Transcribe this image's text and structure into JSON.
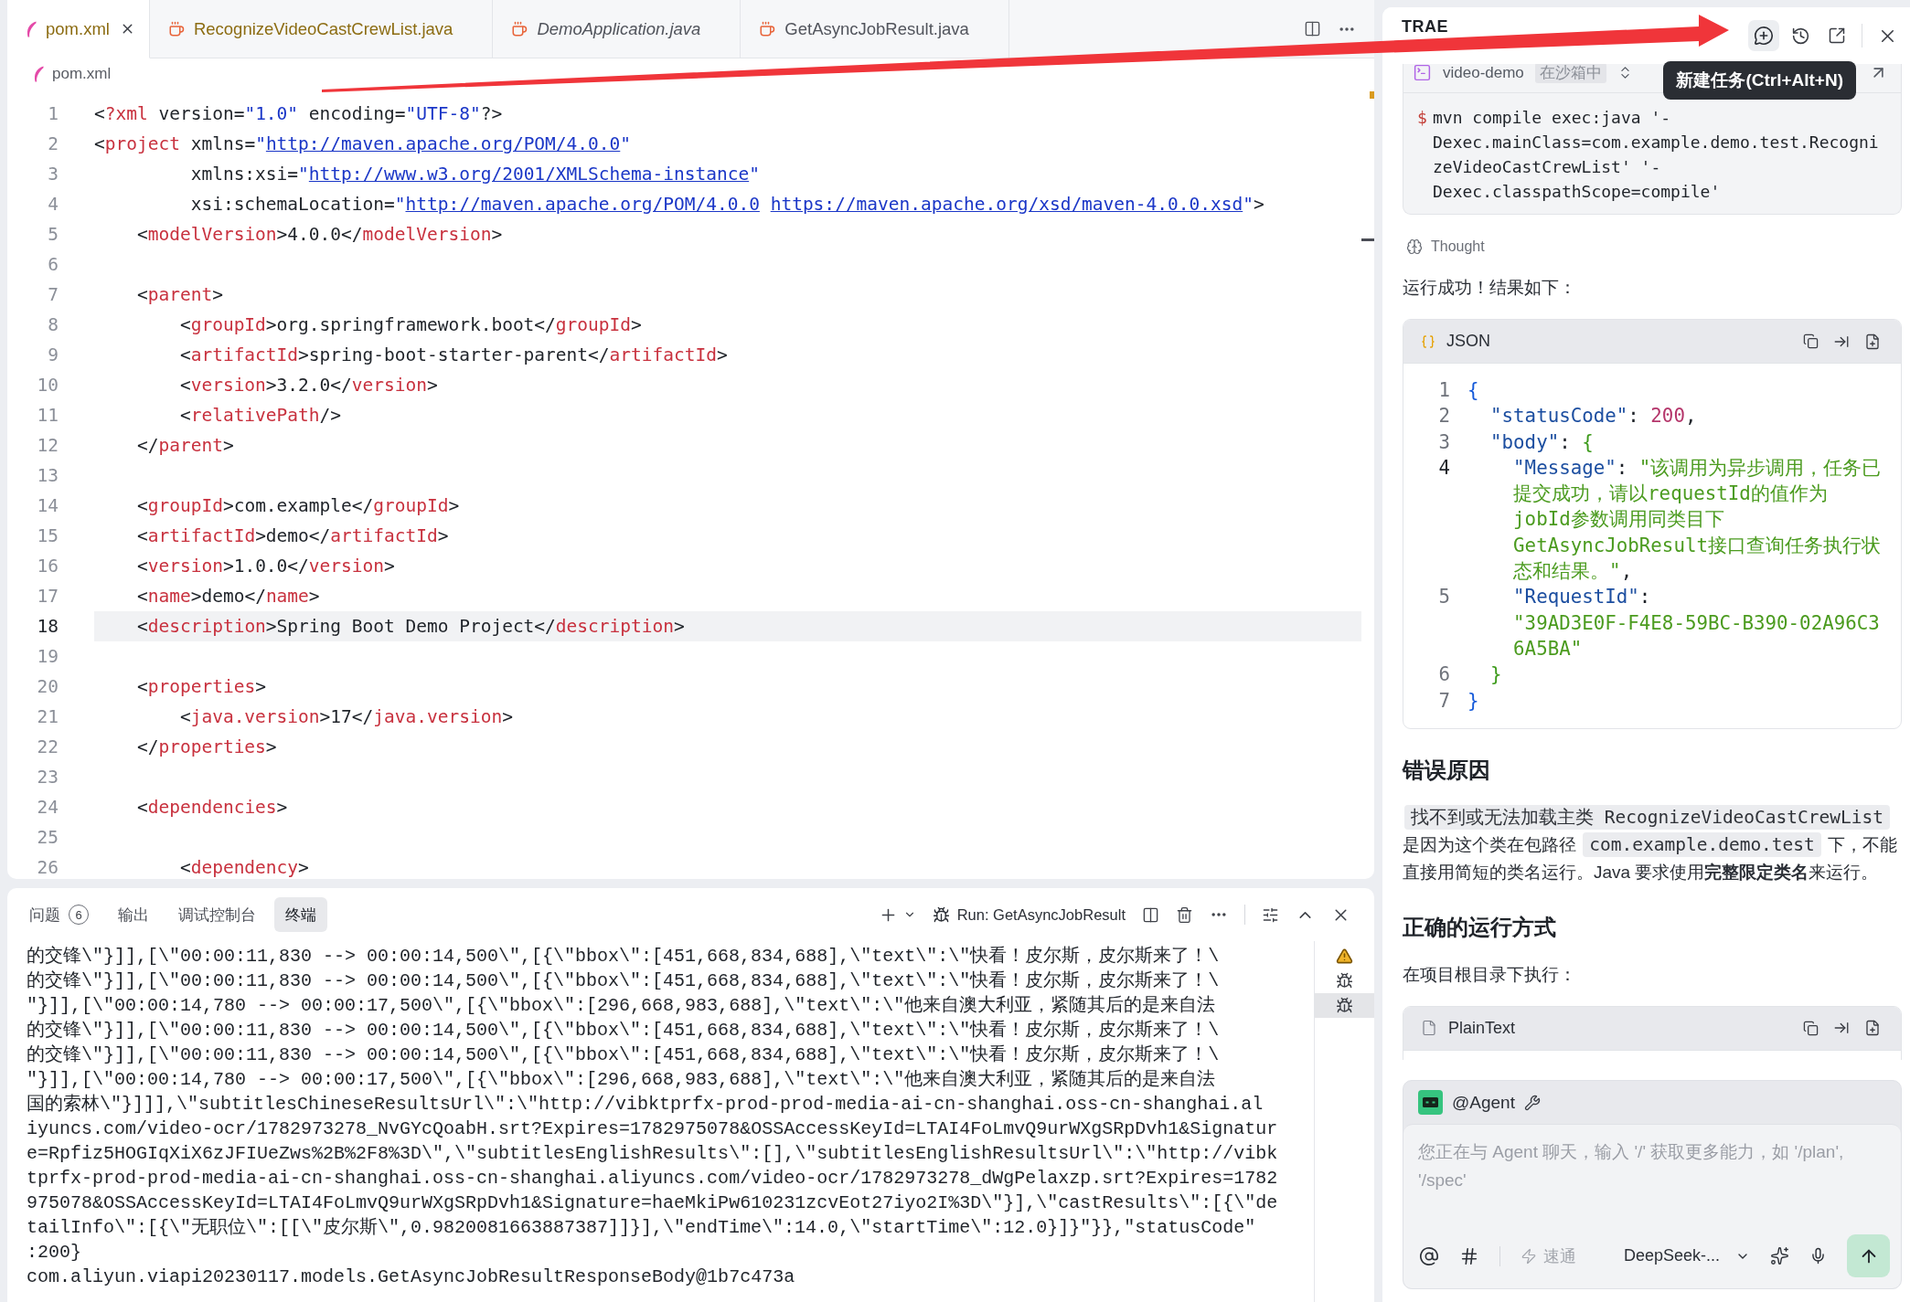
{
  "editor": {
    "tabs": [
      {
        "label": "pom.xml",
        "kind": "xml",
        "selected": true,
        "warning": true,
        "preview": false
      },
      {
        "label": "RecognizeVideoCastCrewList.java",
        "kind": "java",
        "selected": false,
        "warning": true,
        "preview": false
      },
      {
        "label": "DemoApplication.java",
        "kind": "java",
        "selected": false,
        "warning": false,
        "preview": true
      },
      {
        "label": "GetAsyncJobResult.java",
        "kind": "java",
        "selected": false,
        "warning": false,
        "preview": false
      }
    ],
    "breadcrumb": {
      "kind": "xml",
      "label": "pom.xml"
    },
    "lines": [
      {
        "number": "1",
        "current": false,
        "tokens": [
          {
            "kind": "plain",
            "text": "<"
          },
          {
            "kind": "tag",
            "text": "?xml"
          },
          {
            "kind": "plain",
            "text": " version="
          },
          {
            "kind": "string",
            "text": "\"1.0\""
          },
          {
            "kind": "plain",
            "text": " encoding="
          },
          {
            "kind": "string",
            "text": "\"UTF-8\""
          },
          {
            "kind": "plain",
            "text": "?>"
          }
        ]
      },
      {
        "number": "2",
        "current": false,
        "tokens": [
          {
            "kind": "plain",
            "text": "<"
          },
          {
            "kind": "tag",
            "text": "project"
          },
          {
            "kind": "plain",
            "text": " xmlns="
          },
          {
            "kind": "string",
            "text": "\""
          },
          {
            "kind": "link",
            "text": "http://maven.apache.org/POM/4.0.0"
          },
          {
            "kind": "string",
            "text": "\""
          }
        ]
      },
      {
        "number": "3",
        "current": false,
        "tokens": [
          {
            "kind": "plain",
            "text": "         xmlns:xsi="
          },
          {
            "kind": "string",
            "text": "\""
          },
          {
            "kind": "link",
            "text": "http://www.w3.org/2001/XMLSchema-instance"
          },
          {
            "kind": "string",
            "text": "\""
          }
        ]
      },
      {
        "number": "4",
        "current": false,
        "tokens": [
          {
            "kind": "plain",
            "text": "         xsi:schemaLocation="
          },
          {
            "kind": "string",
            "text": "\""
          },
          {
            "kind": "link",
            "text": "http://maven.apache.org/POM/4.0.0"
          },
          {
            "kind": "link",
            "text": "https://maven.apache.org/xsd/maven-4.0.0.xsd"
          },
          {
            "kind": "string",
            "text": "\""
          },
          {
            "kind": "plain",
            "text": ">"
          }
        ]
      },
      {
        "number": "5",
        "current": false,
        "tokens": [
          {
            "kind": "plain",
            "text": "    <"
          },
          {
            "kind": "tag",
            "text": "modelVersion"
          },
          {
            "kind": "plain",
            "text": ">4.0.0</"
          },
          {
            "kind": "tag",
            "text": "modelVersion"
          },
          {
            "kind": "plain",
            "text": ">"
          }
        ]
      },
      {
        "number": "6",
        "current": false
      },
      {
        "number": "7",
        "current": false,
        "tokens": [
          {
            "kind": "plain",
            "text": "    <"
          },
          {
            "kind": "tag",
            "text": "parent"
          },
          {
            "kind": "plain",
            "text": ">"
          }
        ]
      },
      {
        "number": "8",
        "current": false,
        "tokens": [
          {
            "kind": "plain",
            "text": "        <"
          },
          {
            "kind": "tag",
            "text": "groupId"
          },
          {
            "kind": "plain",
            "text": ">org.springframework.boot</"
          },
          {
            "kind": "tag",
            "text": "groupId"
          },
          {
            "kind": "plain",
            "text": ">"
          }
        ]
      },
      {
        "number": "9",
        "current": false,
        "tokens": [
          {
            "kind": "plain",
            "text": "        <"
          },
          {
            "kind": "tag",
            "text": "artifactId"
          },
          {
            "kind": "plain",
            "text": ">spring-boot-starter-parent</"
          },
          {
            "kind": "tag",
            "text": "artifactId"
          },
          {
            "kind": "plain",
            "text": ">"
          }
        ]
      },
      {
        "number": "10",
        "current": false,
        "tokens": [
          {
            "kind": "plain",
            "text": "        <"
          },
          {
            "kind": "tag",
            "text": "version"
          },
          {
            "kind": "plain",
            "text": ">3.2.0</"
          },
          {
            "kind": "tag",
            "text": "version"
          },
          {
            "kind": "plain",
            "text": ">"
          }
        ]
      },
      {
        "number": "11",
        "current": false,
        "tokens": [
          {
            "kind": "plain",
            "text": "        <"
          },
          {
            "kind": "tag",
            "text": "relativePath"
          },
          {
            "kind": "plain",
            "text": "/>"
          }
        ]
      },
      {
        "number": "12",
        "current": false,
        "tokens": [
          {
            "kind": "plain",
            "text": "    </"
          },
          {
            "kind": "tag",
            "text": "parent"
          },
          {
            "kind": "plain",
            "text": ">"
          }
        ]
      },
      {
        "number": "13",
        "current": false
      },
      {
        "number": "14",
        "current": false,
        "tokens": [
          {
            "kind": "plain",
            "text": "    <"
          },
          {
            "kind": "tag",
            "text": "groupId"
          },
          {
            "kind": "plain",
            "text": ">com.example</"
          },
          {
            "kind": "tag",
            "text": "groupId"
          },
          {
            "kind": "plain",
            "text": ">"
          }
        ]
      },
      {
        "number": "15",
        "current": false,
        "tokens": [
          {
            "kind": "plain",
            "text": "    <"
          },
          {
            "kind": "tag",
            "text": "artifactId"
          },
          {
            "kind": "plain",
            "text": ">demo</"
          },
          {
            "kind": "tag",
            "text": "artifactId"
          },
          {
            "kind": "plain",
            "text": ">"
          }
        ]
      },
      {
        "number": "16",
        "current": false,
        "tokens": [
          {
            "kind": "plain",
            "text": "    <"
          },
          {
            "kind": "tag",
            "text": "version"
          },
          {
            "kind": "plain",
            "text": ">1.0.0</"
          },
          {
            "kind": "tag",
            "text": "version"
          },
          {
            "kind": "plain",
            "text": ">"
          }
        ]
      },
      {
        "number": "17",
        "current": false,
        "tokens": [
          {
            "kind": "plain",
            "text": "    <"
          },
          {
            "kind": "tag",
            "text": "name"
          },
          {
            "kind": "plain",
            "text": ">demo</"
          },
          {
            "kind": "tag",
            "text": "name"
          },
          {
            "kind": "plain",
            "text": ">"
          }
        ]
      },
      {
        "number": "18",
        "current": true,
        "tokens": [
          {
            "kind": "plain",
            "text": "    <"
          },
          {
            "kind": "tag",
            "text": "description"
          },
          {
            "kind": "plain",
            "text": ">Spring Boot Demo Project</"
          },
          {
            "kind": "tag",
            "text": "description"
          },
          {
            "kind": "plain",
            "text": ">"
          }
        ]
      },
      {
        "number": "19",
        "current": false
      },
      {
        "number": "20",
        "current": false,
        "tokens": [
          {
            "kind": "plain",
            "text": "    <"
          },
          {
            "kind": "tag",
            "text": "properties"
          },
          {
            "kind": "plain",
            "text": ">"
          }
        ]
      },
      {
        "number": "21",
        "current": false,
        "tokens": [
          {
            "kind": "plain",
            "text": "        <"
          },
          {
            "kind": "tag",
            "text": "java.version"
          },
          {
            "kind": "plain",
            "text": ">17</"
          },
          {
            "kind": "tag",
            "text": "java.version"
          },
          {
            "kind": "plain",
            "text": ">"
          }
        ]
      },
      {
        "number": "22",
        "current": false,
        "tokens": [
          {
            "kind": "plain",
            "text": "    </"
          },
          {
            "kind": "tag",
            "text": "properties"
          },
          {
            "kind": "plain",
            "text": ">"
          }
        ]
      },
      {
        "number": "23",
        "current": false
      },
      {
        "number": "24",
        "current": false,
        "tokens": [
          {
            "kind": "plain",
            "text": "    <"
          },
          {
            "kind": "tag",
            "text": "dependencies"
          },
          {
            "kind": "plain",
            "text": ">"
          }
        ]
      },
      {
        "number": "25",
        "current": false
      },
      {
        "number": "26",
        "current": false,
        "tokens": [
          {
            "kind": "plain",
            "text": "        <"
          },
          {
            "kind": "tag",
            "text": "dependency"
          },
          {
            "kind": "plain",
            "text": ">"
          }
        ]
      }
    ]
  },
  "panel": {
    "tabs": [
      {
        "label": "问题",
        "badge": "6",
        "selected": false
      },
      {
        "label": "输出",
        "selected": false
      },
      {
        "label": "调试控制台",
        "selected": false
      },
      {
        "label": "终端",
        "selected": true
      }
    ],
    "run_label": "Run: GetAsyncJobResult",
    "output": [
      "的交锋\\\"}]],[\\\"00:00:11,830 --> 00:00:14,500\\\",[{\\\"bbox\\\":[451,668,834,688],\\\"text\\\":\\\"快看！皮尔斯，皮尔斯来了！\\",
      "的交锋\\\"}]],[\\\"00:00:11,830 --> 00:00:14,500\\\",[{\\\"bbox\\\":[451,668,834,688],\\\"text\\\":\\\"快看！皮尔斯，皮尔斯来了！\\",
      "\"}]],[\\\"00:00:14,780 --> 00:00:17,500\\\",[{\\\"bbox\\\":[296,668,983,688],\\\"text\\\":\\\"他来自澳大利亚，紧随其后的是来自法",
      "的交锋\\\"}]],[\\\"00:00:11,830 --> 00:00:14,500\\\",[{\\\"bbox\\\":[451,668,834,688],\\\"text\\\":\\\"快看！皮尔斯，皮尔斯来了！\\",
      "的交锋\\\"}]],[\\\"00:00:11,830 --> 00:00:14,500\\\",[{\\\"bbox\\\":[451,668,834,688],\\\"text\\\":\\\"快看！皮尔斯，皮尔斯来了！\\",
      "\"}]],[\\\"00:00:14,780 --> 00:00:17,500\\\",[{\\\"bbox\\\":[296,668,983,688],\\\"text\\\":\\\"他来自澳大利亚，紧随其后的是来自法",
      "国的索林\\\"}]]],\\\"subtitlesChineseResultsUrl\\\":\\\"http://vibktprfx-prod-prod-media-ai-cn-shanghai.oss-cn-shanghai.al",
      "iyuncs.com/video-ocr/1782973278_NvGYcQoabH.srt?Expires=1782975078&OSSAccessKeyId=LTAI4FoLmvQ9urWXgSRpDvh1&Signatur",
      "e=Rpfiz5HOGIqXiX6zJFIUeZws%2B%2F8%3D\\\",\\\"subtitlesEnglishResults\\\":[],\\\"subtitlesEnglishResultsUrl\\\":\\\"http://vibk",
      "tprfx-prod-prod-media-ai-cn-shanghai.oss-cn-shanghai.aliyuncs.com/video-ocr/1782973278_dWgPelaxzp.srt?Expires=1782",
      "975078&OSSAccessKeyId=LTAI4FoLmvQ9urWXgSRpDvh1&Signature=haeMkiPw610231zcvEot27iyo2I%3D\\\"}],\\\"castResults\\\":[{\\\"de",
      "tailInfo\\\":[{\\\"无职位\\\":[[\\\"皮尔斯\\\",0.9820081663887387]]}],\\\"endTime\\\":14.0,\\\"startTime\\\":12.0}]}\"}},\"statusCode\"",
      ":200}",
      "com.aliyun.viapi20230117.models.GetAsyncJobResultResponseBody@1b7c473a"
    ],
    "sessions": [
      {
        "kind": "warning",
        "selected": false
      },
      {
        "kind": "debug",
        "selected": false
      },
      {
        "kind": "debug",
        "selected": true
      }
    ]
  },
  "assistant": {
    "title": "TRAE",
    "new_task": {
      "highlighted": true,
      "tooltip": "新建任务(Ctrl+Alt+N)"
    },
    "blocks": [
      {
        "kind": "command",
        "name": "video-demo",
        "badge": "在沙箱中",
        "prompt": "$",
        "command": "mvn compile exec:java '-Dexec.mainClass=com.example.demo.test.RecognizeVideoCastCrewList' '-Dexec.classpathScope=compile'"
      },
      {
        "kind": "thought",
        "text": "Thought"
      },
      {
        "kind": "paragraph",
        "segments": [
          {
            "kind": "text",
            "text": "运行成功！结果如下："
          }
        ]
      },
      {
        "kind": "code_json",
        "label": "JSON",
        "lines": [
          {
            "number": "1",
            "current": false,
            "tokens": [
              {
                "kind": "brace_outer",
                "text": "{"
              }
            ]
          },
          {
            "number": "2",
            "current": false,
            "tokens": [
              {
                "kind": "key",
                "text": "  \"statusCode\""
              },
              {
                "kind": "punct",
                "text": ": "
              },
              {
                "kind": "number",
                "text": "200"
              },
              {
                "kind": "punct",
                "text": ","
              }
            ]
          },
          {
            "number": "3",
            "current": false,
            "tokens": [
              {
                "kind": "key",
                "text": "  \"body\""
              },
              {
                "kind": "punct",
                "text": ": "
              },
              {
                "kind": "brace_inner",
                "text": "{"
              }
            ]
          },
          {
            "number": "4",
            "current": true,
            "tokens": [
              {
                "kind": "key",
                "text": "    \"Message\""
              },
              {
                "kind": "punct",
                "text": ": "
              },
              {
                "kind": "string",
                "text": "\"该调用为异步调用，任务已提交成功，请以requestId的值作为jobId参数调用同类目下GetAsyncJobResult接口查询任务执行状态和结果。\""
              },
              {
                "kind": "punct",
                "text": ","
              }
            ]
          },
          {
            "number": "5",
            "current": false,
            "tokens": [
              {
                "kind": "key",
                "text": "    \"RequestId\""
              },
              {
                "kind": "punct",
                "text": ": "
              },
              {
                "kind": "id",
                "text": "\"39AD3E0F-F4E8-59BC-B390-02A96C36A5BA\""
              }
            ]
          },
          {
            "number": "6",
            "current": false,
            "tokens": [
              {
                "kind": "brace_inner",
                "text": "  }"
              }
            ]
          },
          {
            "number": "7",
            "current": false,
            "tokens": [
              {
                "kind": "brace_outer",
                "text": "}"
              }
            ]
          }
        ]
      },
      {
        "kind": "heading",
        "text": "错误原因"
      },
      {
        "kind": "paragraph",
        "segments": [
          {
            "kind": "code",
            "text": "找不到或无法加载主类 RecognizeVideoCastCrewList"
          },
          {
            "kind": "text",
            "text": "是因为这个类在包路径"
          },
          {
            "kind": "code",
            "text": "com.example.demo.test"
          },
          {
            "kind": "text",
            "text": "下，不能直接用简短的类名运行。Java 要求使用**完整限定类名**来运行。"
          }
        ]
      },
      {
        "kind": "heading",
        "text": "正确的运行方式"
      },
      {
        "kind": "paragraph",
        "segments": [
          {
            "kind": "text",
            "text": "在项目根目录下执行："
          }
        ]
      },
      {
        "kind": "code_plain",
        "label": "PlainText"
      }
    ],
    "chat": {
      "agent": "@Agent",
      "placeholder": "您正在与 Agent 聊天，输入 '/' 获取更多能力，如 '/plan', '/spec'",
      "mode": {
        "label": "速通",
        "on": false
      },
      "model": "DeepSeek-...",
      "send": {
        "disabled": true
      }
    }
  }
}
